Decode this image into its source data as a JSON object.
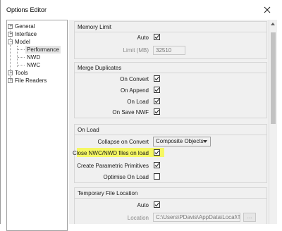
{
  "window": {
    "title": "Options Editor"
  },
  "tree": {
    "items": [
      {
        "label": "General",
        "expander": "+"
      },
      {
        "label": "Interface",
        "expander": "+"
      },
      {
        "label": "Model",
        "expander": "−"
      },
      {
        "label": "Performance",
        "selected": true
      },
      {
        "label": "NWD"
      },
      {
        "label": "NWC"
      },
      {
        "label": "Tools",
        "expander": "+"
      },
      {
        "label": "File Readers",
        "expander": "+"
      }
    ]
  },
  "memory_limit": {
    "title": "Memory Limit",
    "auto_label": "Auto",
    "auto_checked": true,
    "limit_label": "Limit (MB)",
    "limit_value": "32510"
  },
  "merge_duplicates": {
    "title": "Merge Duplicates",
    "rows": [
      {
        "label": "On Convert",
        "checked": true
      },
      {
        "label": "On Append",
        "checked": true
      },
      {
        "label": "On Load",
        "checked": true
      },
      {
        "label": "On Save NWF",
        "checked": true
      }
    ]
  },
  "on_load": {
    "title": "On Load",
    "collapse_label": "Collapse on Convert",
    "collapse_value": "Composite Objects",
    "rows": [
      {
        "label": "Close NWC/NWD files on load",
        "checked": true
      },
      {
        "label": "Create Parametric Primitives",
        "checked": true
      },
      {
        "label": "Optimise On Load",
        "checked": false
      }
    ]
  },
  "temp_location": {
    "title": "Temporary File Location",
    "auto_label": "Auto",
    "auto_checked": true,
    "location_label": "Location",
    "location_value": "C:\\Users\\PDavis\\AppData\\Local\\Te",
    "browse_label": "..."
  },
  "colors": {
    "highlight": "#f6f84a",
    "panel": "#f0f0f0"
  }
}
